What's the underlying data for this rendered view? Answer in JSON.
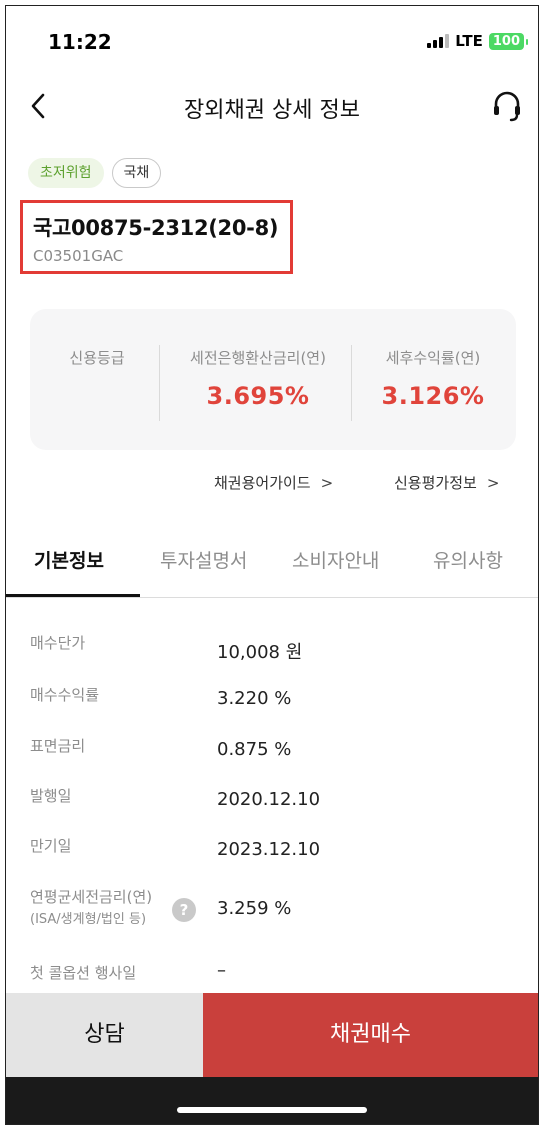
{
  "status_bar": {
    "time": "11:22",
    "network": "LTE",
    "battery": "100"
  },
  "nav": {
    "title": "장외채권 상세 정보",
    "back_icon": "chevron-left-icon",
    "support_icon": "headset-icon"
  },
  "badges": {
    "risk": "초저위험",
    "type": "국채"
  },
  "bond": {
    "name": "국고00875-2312(20-8)",
    "code": "C03501GAC"
  },
  "summary": {
    "credit_rating_label": "신용등급",
    "pretax_rate_label": "세전은행환산금리(연)",
    "pretax_rate_value": "3.695%",
    "aftertax_yield_label": "세후수익률(연)",
    "aftertax_yield_value": "3.126%"
  },
  "links": {
    "glossary": "채권용어가이드",
    "credit_info": "신용평가정보",
    "chevron": ">"
  },
  "tabs": [
    {
      "label": "기본정보"
    },
    {
      "label": "투자설명서"
    },
    {
      "label": "소비자안내"
    },
    {
      "label": "유의사항"
    }
  ],
  "details": [
    {
      "label": "매수단가",
      "value": "10,008 원"
    },
    {
      "label": "매수수익률",
      "value": "3.220 %"
    },
    {
      "label": "표면금리",
      "value": "0.875 %"
    },
    {
      "label": "발행일",
      "value": "2020.12.10"
    },
    {
      "label": "만기일",
      "value": "2023.12.10"
    },
    {
      "label": "연평균세전금리(연)",
      "sublabel": "(ISA/생계형/법인 등)",
      "value": "3.259 %",
      "help": "?"
    },
    {
      "label": "첫 콜옵션 행사일",
      "value": "–"
    }
  ],
  "actions": {
    "consult": "상담",
    "buy": "채권매수"
  },
  "colors": {
    "accent_red": "#e0443b",
    "buy_button": "#c9403c",
    "risk_green": "#5da12f",
    "highlight_box": "#e23b35"
  }
}
